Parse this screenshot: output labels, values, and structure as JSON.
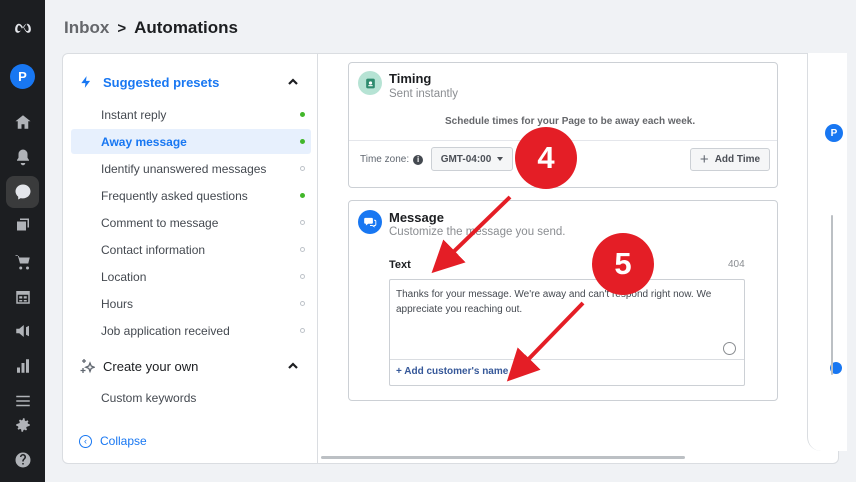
{
  "rail": {
    "avatar_letter": "P",
    "icons": [
      "meta-logo-icon",
      "home-icon",
      "notifications-icon",
      "inbox-icon",
      "posts-icon",
      "shop-icon",
      "calendar-icon",
      "ads-icon",
      "insights-icon",
      "menu-icon",
      "settings-icon",
      "help-icon"
    ]
  },
  "header": {
    "inbox": "Inbox",
    "separator": ">",
    "current": "Automations"
  },
  "sidebar": {
    "presets_title": "Suggested presets",
    "items": [
      {
        "label": "Instant reply",
        "active": true
      },
      {
        "label": "Away message",
        "active": true,
        "selected": true
      },
      {
        "label": "Identify unanswered messages",
        "active": false
      },
      {
        "label": "Frequently asked questions",
        "active": true
      },
      {
        "label": "Comment to message",
        "active": false
      },
      {
        "label": "Contact information",
        "active": false
      },
      {
        "label": "Location",
        "active": false
      },
      {
        "label": "Hours",
        "active": false
      },
      {
        "label": "Job application received",
        "active": false
      }
    ],
    "create_title": "Create your own",
    "create_items": [
      {
        "label": "Custom keywords"
      }
    ],
    "collapse": "Collapse"
  },
  "timing": {
    "title": "Timing",
    "subtitle": "Sent instantly",
    "schedule_text": "Schedule times for your Page to be away each week.",
    "timezone_label": "Time zone:",
    "timezone_value": "GMT-04:00",
    "add_time": "Add Time"
  },
  "message": {
    "title": "Message",
    "subtitle": "Customize the message you send.",
    "text_label": "Text",
    "char_count": "404",
    "body": "Thanks for your message. We're away and can't respond right now. We appreciate you reaching out.",
    "add_name": "+ Add customer's name"
  },
  "annotations": {
    "step4": "4",
    "step5": "5",
    "color": "#e41e26"
  },
  "peek": {
    "avatar_letter": "P"
  },
  "colors": {
    "accent": "#1877f2",
    "rail": "#1c1e21",
    "active_dot": "#42b72a"
  }
}
